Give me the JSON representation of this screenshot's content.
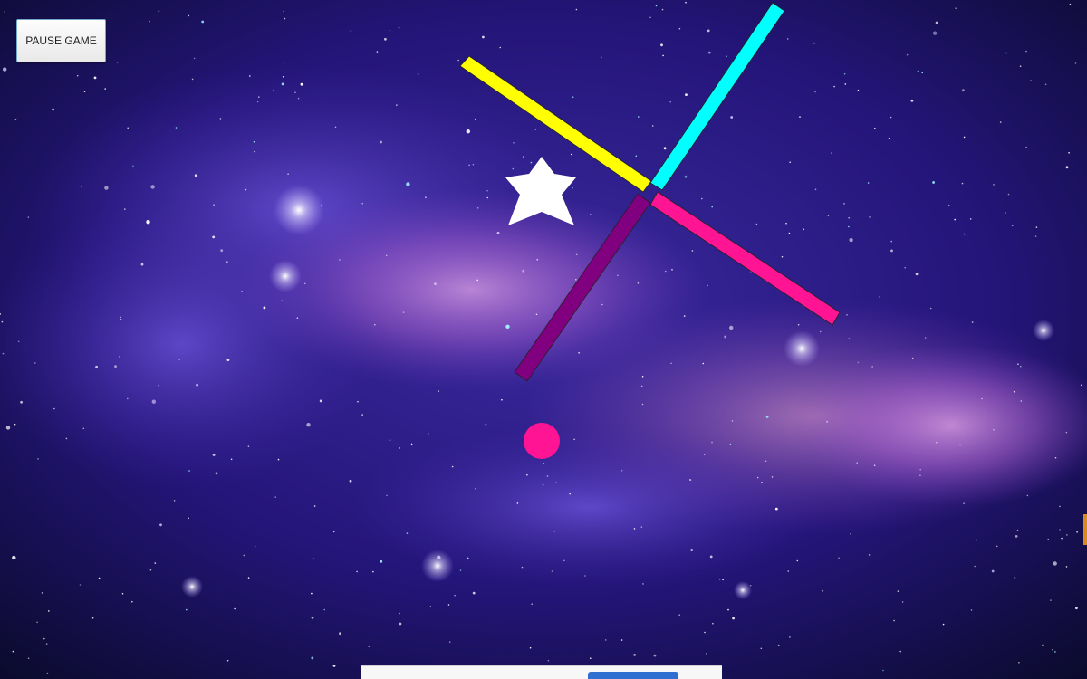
{
  "pause_button": {
    "label": "PAUSE GAME"
  },
  "game": {
    "obstacle_cross": {
      "arms": [
        {
          "color": "#FFFF00",
          "name": "yellow"
        },
        {
          "color": "#00FFFF",
          "name": "cyan"
        },
        {
          "color": "#FF1493",
          "name": "pink"
        },
        {
          "color": "#800080",
          "name": "purple"
        }
      ]
    },
    "player_ball": {
      "color": "#FF1493"
    },
    "star": {
      "color": "#FFFFFF",
      "icon": "star-icon"
    }
  },
  "colors": {
    "space_dark": "#0b0b2e",
    "space_mid": "#3a1f8f",
    "nebula_pink": "#c27bd6"
  }
}
